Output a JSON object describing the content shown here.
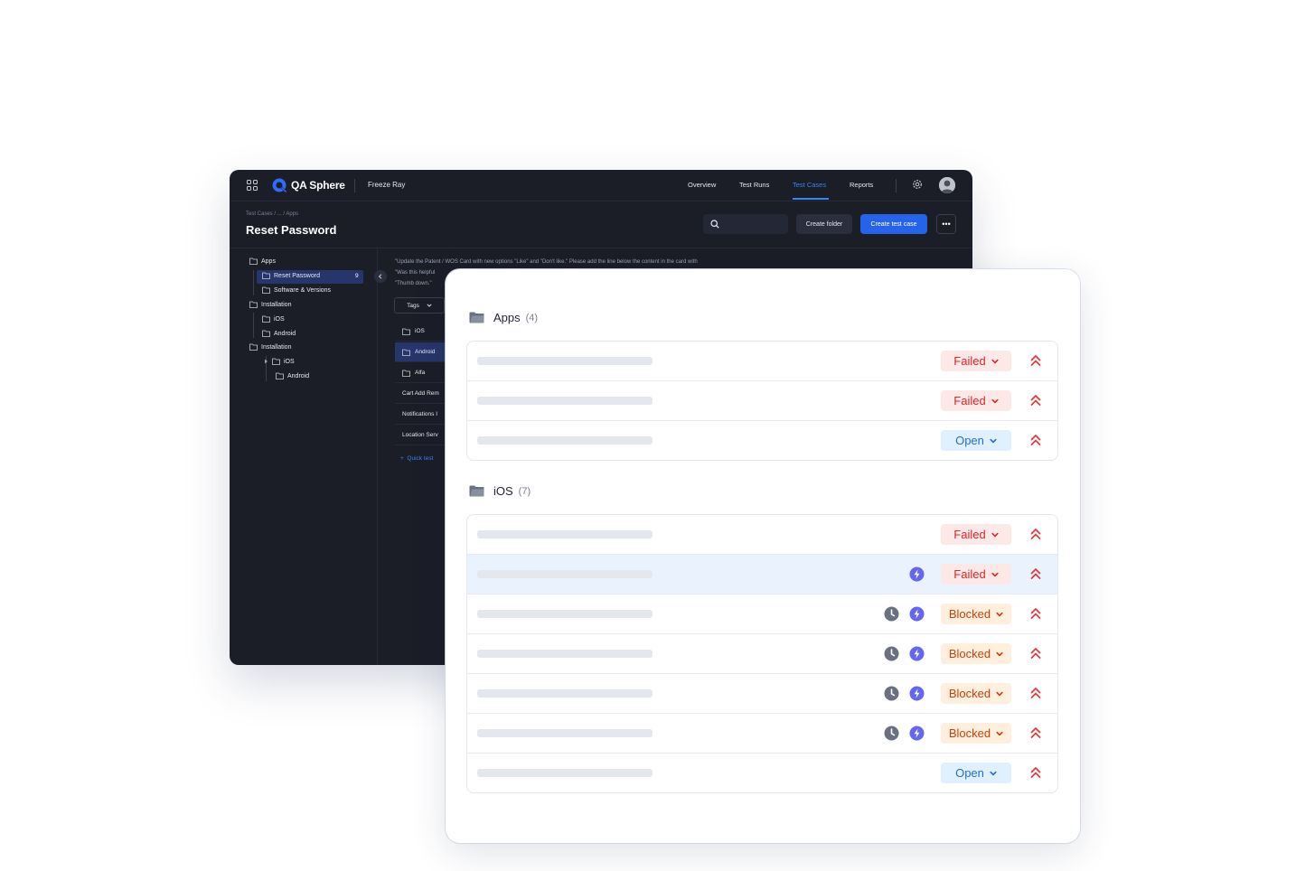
{
  "app": {
    "logo_text": "QA Sphere",
    "project": "Freeze Ray",
    "nav": [
      "Overview",
      "Test Runs",
      "Test Cases",
      "Reports"
    ],
    "active_nav": "Test Cases",
    "breadcrumb": "Test Cases   /   ...   /   Apps",
    "page_title": "Reset Password",
    "create_folder": "Create folder",
    "create_test_case": "Create test case",
    "more": "•••",
    "tree": [
      {
        "label": "Apps"
      },
      {
        "label": "Reset Password",
        "count": "9"
      },
      {
        "label": "Software & Versions"
      },
      {
        "label": "Installation"
      },
      {
        "label": "iOS"
      },
      {
        "label": "Android"
      },
      {
        "label": "Installation"
      },
      {
        "label": "iOS"
      },
      {
        "label": "Android"
      }
    ],
    "description": [
      "\"Update the Patent / WOS Card with new options \"Like\" and \"Don't like.\" Please add the line below the content in the card with",
      "\"Was this helpful",
      "\"Thumb down.\""
    ],
    "tags_label": "Tags",
    "middle_items": [
      "iOS",
      "Android",
      "Alfa",
      "Cart Add Rem",
      "Notifications I",
      "Location Serv"
    ],
    "quick_label": "Quick test"
  },
  "groups": [
    {
      "name": "Apps",
      "count": "(4)",
      "rows": [
        {
          "status": "Failed",
          "kind": "failed",
          "clock": false,
          "bolt": false,
          "highlight": false
        },
        {
          "status": "Failed",
          "kind": "failed",
          "clock": false,
          "bolt": false,
          "highlight": false
        },
        {
          "status": "Open",
          "kind": "open",
          "clock": false,
          "bolt": false,
          "highlight": false
        }
      ]
    },
    {
      "name": "iOS",
      "count": "(7)",
      "rows": [
        {
          "status": "Failed",
          "kind": "failed",
          "clock": false,
          "bolt": false,
          "highlight": false
        },
        {
          "status": "Failed",
          "kind": "failed",
          "clock": false,
          "bolt": true,
          "highlight": true
        },
        {
          "status": "Blocked",
          "kind": "blocked",
          "clock": true,
          "bolt": true,
          "highlight": false
        },
        {
          "status": "Blocked",
          "kind": "blocked",
          "clock": true,
          "bolt": true,
          "highlight": false
        },
        {
          "status": "Blocked",
          "kind": "blocked",
          "clock": true,
          "bolt": true,
          "highlight": false
        },
        {
          "status": "Blocked",
          "kind": "blocked",
          "clock": true,
          "bolt": true,
          "highlight": false
        },
        {
          "status": "Open",
          "kind": "open",
          "clock": false,
          "bolt": false,
          "highlight": false
        }
      ]
    }
  ],
  "colors": {
    "accent": "#2563eb",
    "failed": "#dc2626",
    "open": "#1d6fd1",
    "blocked": "#c2410c",
    "priority": "#e23b3b",
    "bolt": "#6366f1"
  },
  "icons": [
    "apps-grid-icon",
    "qa-sphere-logo",
    "gear-icon",
    "avatar",
    "search-icon",
    "folder-icon",
    "chevron-down-icon",
    "priority-high-icon",
    "clock-icon",
    "bolt-icon"
  ]
}
